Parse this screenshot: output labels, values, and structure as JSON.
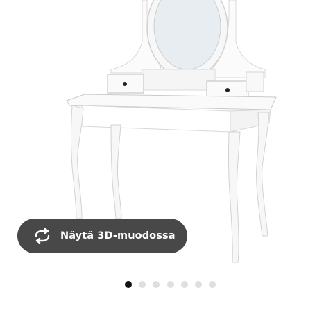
{
  "product": {
    "image_icon": "vanity-dressing-table-with-oval-mirror"
  },
  "view_3d": {
    "label": "Näytä 3D-muodossa",
    "icon": "rotate-arrows-icon"
  },
  "carousel": {
    "total": 7,
    "current": 1
  },
  "colors": {
    "button_bg": "#343434",
    "dot_active": "#111111",
    "dot_inactive": "#dfdfdf"
  }
}
